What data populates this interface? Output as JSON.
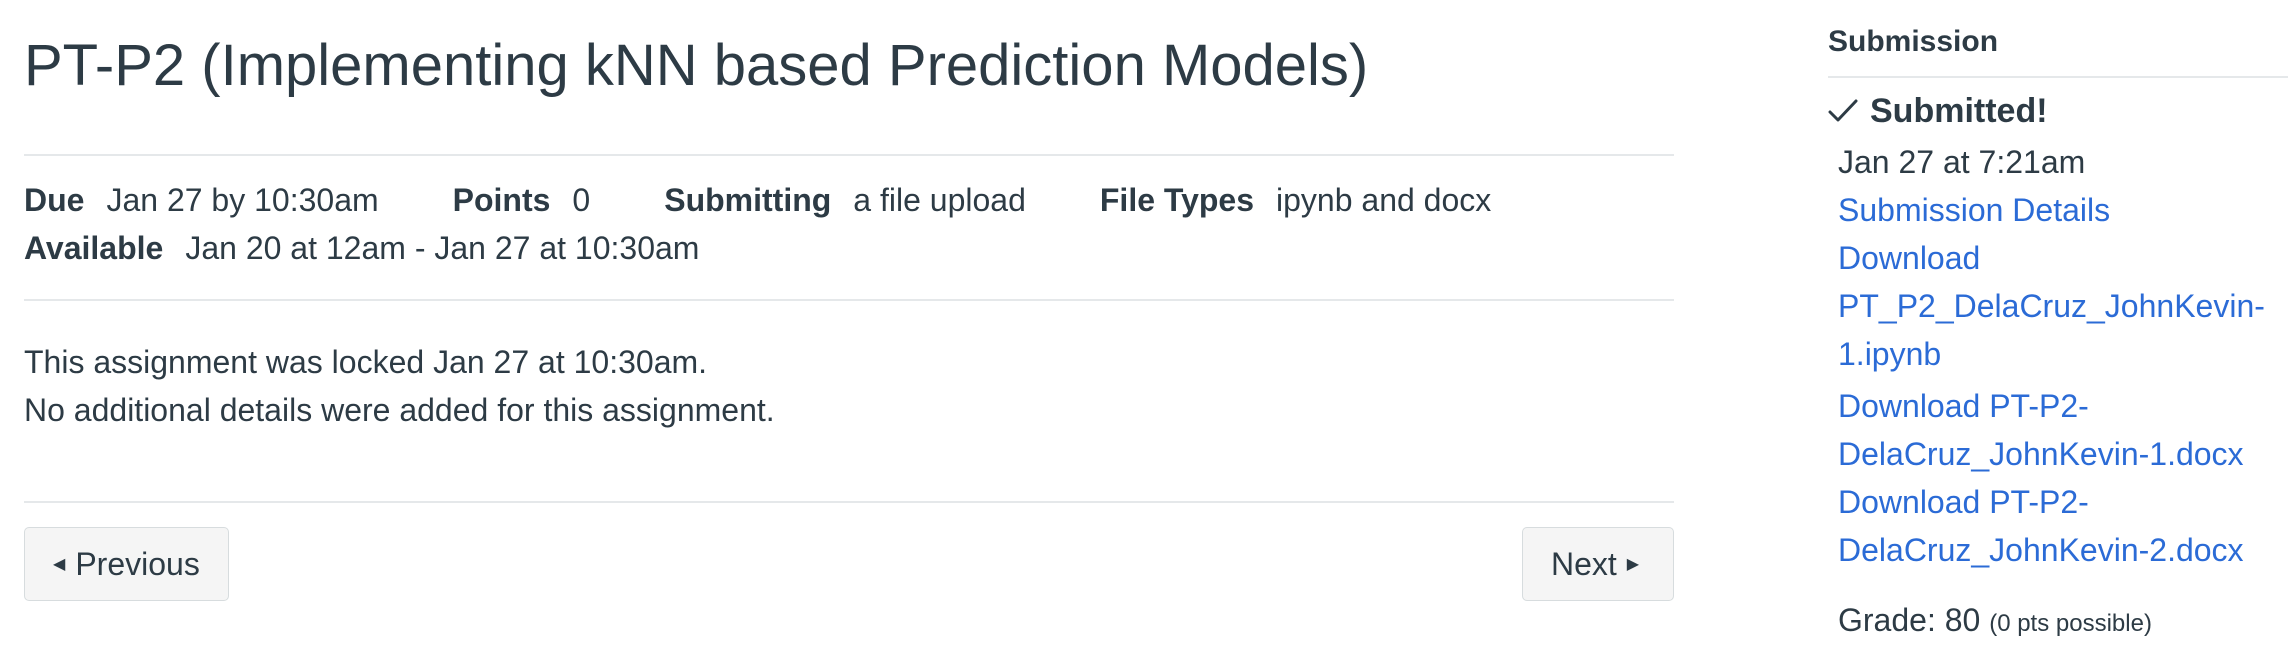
{
  "assignment": {
    "title": "PT-P2 (Implementing kNN based Prediction Models)",
    "due_label": "Due",
    "due_value": "Jan 27 by 10:30am",
    "points_label": "Points",
    "points_value": "0",
    "submitting_label": "Submitting",
    "submitting_value": "a file upload",
    "file_types_label": "File Types",
    "file_types_value": "ipynb and docx",
    "available_label": "Available",
    "available_value": "Jan 20 at 12am - Jan 27 at 10:30am",
    "locked_message": "This assignment was locked Jan 27 at 10:30am.",
    "no_details_message": "No additional details were added for this assignment."
  },
  "navigation": {
    "previous_label": "Previous",
    "next_label": "Next",
    "previous_icon": "caret-left-icon",
    "next_icon": "caret-right-icon"
  },
  "sidebar": {
    "heading": "Submission",
    "status": "Submitted!",
    "status_icon": "checkmark-icon",
    "submitted_at": "Jan 27 at 7:21am",
    "details_link": "Submission Details",
    "downloads": [
      {
        "line1": "Download",
        "line2": "PT_P2_DelaCruz_JohnKevin-",
        "line3": "1.ipynb"
      },
      {
        "line1": "Download PT-P2-",
        "line2": "DelaCruz_JohnKevin-1.docx"
      },
      {
        "line1": "Download PT-P2-",
        "line2": "DelaCruz_JohnKevin-2.docx"
      }
    ],
    "grade_label": "Grade: 80",
    "grade_note": "(0 pts possible)"
  },
  "colors": {
    "text": "#2d3b45",
    "link": "#2b6bd6",
    "divider": "#e5e8ea",
    "button_bg": "#f5f5f5"
  }
}
